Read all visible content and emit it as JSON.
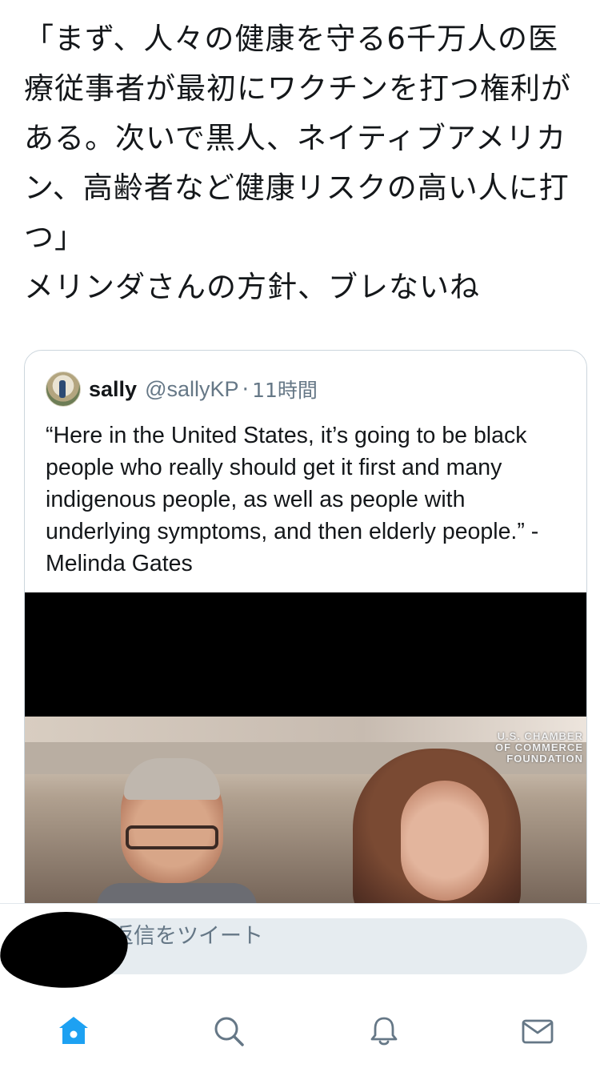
{
  "tweet": {
    "text": "「まず、人々の健康を守る6千万人の医療従事者が最初にワクチンを打つ権利がある。次いで黒人、ネイティブアメリカン、高齢者など健康リスクの高い人に打つ」\nメリンダさんの方針、ブレないね"
  },
  "quoted_tweet": {
    "name": "sally",
    "handle": "@sallyKP",
    "separator": "·",
    "time": "11時間",
    "text": "“Here in the United States, it’s going to be black people who really should get it first and many indigenous people, as well as people with underlying symptoms, and then elderly people.” -Melinda Gates",
    "media_logo": {
      "line1": "U.S. CHAMBER",
      "line2": "OF COMMERCE",
      "line3": "FOUNDATION"
    }
  },
  "reply": {
    "placeholder": "返信をツイート"
  },
  "tabbar": {
    "items": [
      "home-icon",
      "search-icon",
      "notifications-icon",
      "messages-icon"
    ],
    "active": "home-icon",
    "accent": "#1da1f2"
  },
  "colors": {
    "text": "#14171a",
    "secondary": "#657786",
    "border": "#ccd6dd",
    "input_bg": "#e6ecf0"
  }
}
